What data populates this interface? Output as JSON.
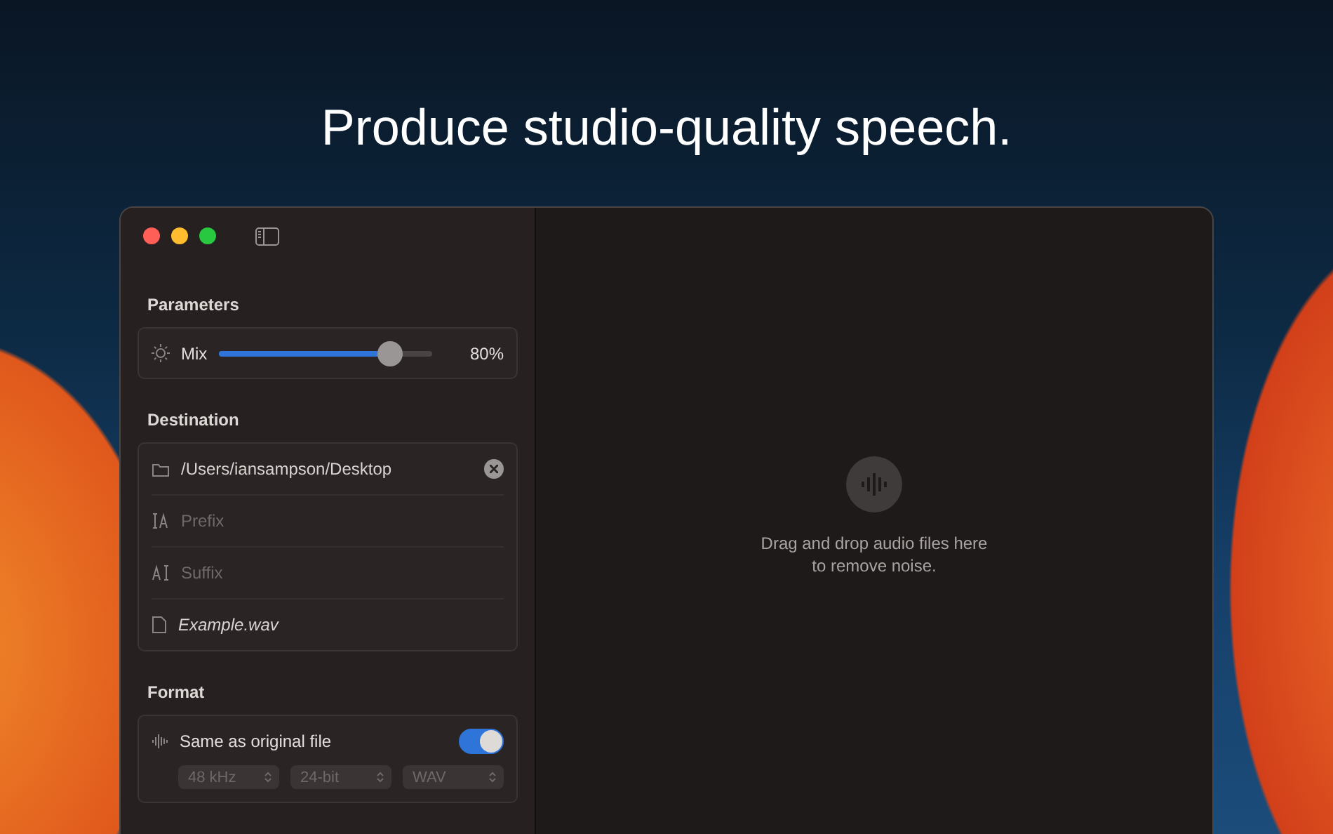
{
  "headline": "Produce studio-quality speech.",
  "parameters": {
    "title": "Parameters",
    "mix": {
      "label": "Mix",
      "level": 0.8,
      "reading": "80%"
    }
  },
  "destination": {
    "title": "Destination",
    "fields": [
      {
        "kind": "path",
        "value": "/Users/iansampson/Desktop"
      },
      {
        "kind": "prefix",
        "placeholder": "Prefix"
      },
      {
        "kind": "suffix",
        "placeholder": "Suffix"
      },
      {
        "kind": "preview",
        "value": "Example.wav"
      }
    ]
  },
  "format": {
    "title": "Format",
    "same_as_original": {
      "label": "Same as original file",
      "on": true
    },
    "popups": [
      {
        "value": "48 kHz",
        "disabled": true
      },
      {
        "value": "24-bit",
        "disabled": true
      },
      {
        "value": "WAV",
        "disabled": true
      }
    ]
  },
  "drop_zone": {
    "message": "Drag and drop audio files here to remove noise."
  }
}
